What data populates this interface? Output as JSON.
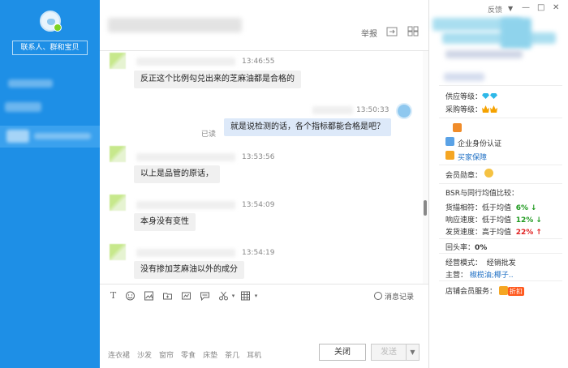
{
  "sidebar": {
    "search_label": "联系人、群和宝贝"
  },
  "header": {
    "report_label": "举报"
  },
  "messages": [
    {
      "time": "13:46:55",
      "text": "反正这个比例勾兑出来的芝麻油都是合格的"
    },
    {
      "time": "13:50:33",
      "text": "就是说检测的话，各个指标都能合格是吧？",
      "read_label": "已读"
    },
    {
      "time": "13:53:56",
      "text": "以上是品管的原话，"
    },
    {
      "time": "13:54:09",
      "text": "本身没有变性"
    },
    {
      "time": "13:54:19",
      "text": "没有掺加芝麻油以外的成分"
    }
  ],
  "toolbar": {
    "history_label": "消息记录"
  },
  "input": {
    "quick_tags": [
      "连衣裙",
      "沙发",
      "窗帘",
      "零食",
      "床垫",
      "茶几",
      "耳机"
    ],
    "close_label": "关闭",
    "send_label": "发送"
  },
  "right_panel": {
    "feedback_label": "反馈",
    "supply_level_label": "供应等级：",
    "purchase_level_label": "采购等级：",
    "enterprise_cert": "企业身份认证",
    "buyer_protection": "买家保障",
    "member_badge_label": "会员勋章：",
    "bsr_title": "BSR与同行均值比较：",
    "metrics": [
      {
        "label": "货描相符：",
        "compare": "低于均值",
        "value": "6%",
        "dir": "down"
      },
      {
        "label": "响应速度：",
        "compare": "低于均值",
        "value": "12%",
        "dir": "down"
      },
      {
        "label": "发货速度：",
        "compare": "高于均值",
        "value": "22%",
        "dir": "up"
      }
    ],
    "repeat_rate_label": "回头率：",
    "repeat_rate_value": "0%",
    "business_mode_label": "经营模式：",
    "business_mode_value": "经销批发",
    "main_business_label": "主营：",
    "main_business_value": "椒榄油;椰子..",
    "store_member_label": "店铺会员服务：",
    "discount_label": "折扣"
  },
  "colors": {
    "sidebar_blue": "#1e8fe6",
    "my_bubble": "#dde9f9",
    "down_green": "#1f9a1f",
    "up_red": "#e02020"
  }
}
